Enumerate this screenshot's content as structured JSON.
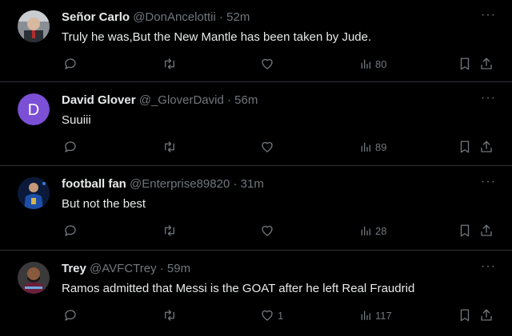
{
  "tweets": [
    {
      "name": "Señor Carlo",
      "handle": "@DonAncelottii",
      "time": "· 52m",
      "text": "Truly he was,But the New Mantle has been taken by Jude.",
      "likes": "",
      "views": "80",
      "avatar": "photo"
    },
    {
      "name": "David Glover",
      "handle": "@_GloverDavid",
      "time": "· 56m",
      "text": "Suuiii",
      "likes": "",
      "views": "89",
      "avatar": "letter",
      "avatar_letter": "D",
      "avatar_color": "#7b4fd6"
    },
    {
      "name": "football fan",
      "handle": "@Enterprise89820",
      "time": "· 31m",
      "text": "But not the best",
      "likes": "",
      "views": "28",
      "avatar": "photo"
    },
    {
      "name": "Trey",
      "handle": "@AVFCTrey",
      "time": "· 59m",
      "text": "Ramos admitted that Messi is the GOAT after he left Real Fraudrid",
      "likes": "1",
      "views": "117",
      "avatar": "photo"
    }
  ],
  "icons": {
    "reply": "reply-icon",
    "retweet": "retweet-icon",
    "like": "heart-icon",
    "views": "views-icon",
    "bookmark": "bookmark-icon",
    "share": "share-icon",
    "more": "more-icon"
  },
  "more_glyph": "···"
}
